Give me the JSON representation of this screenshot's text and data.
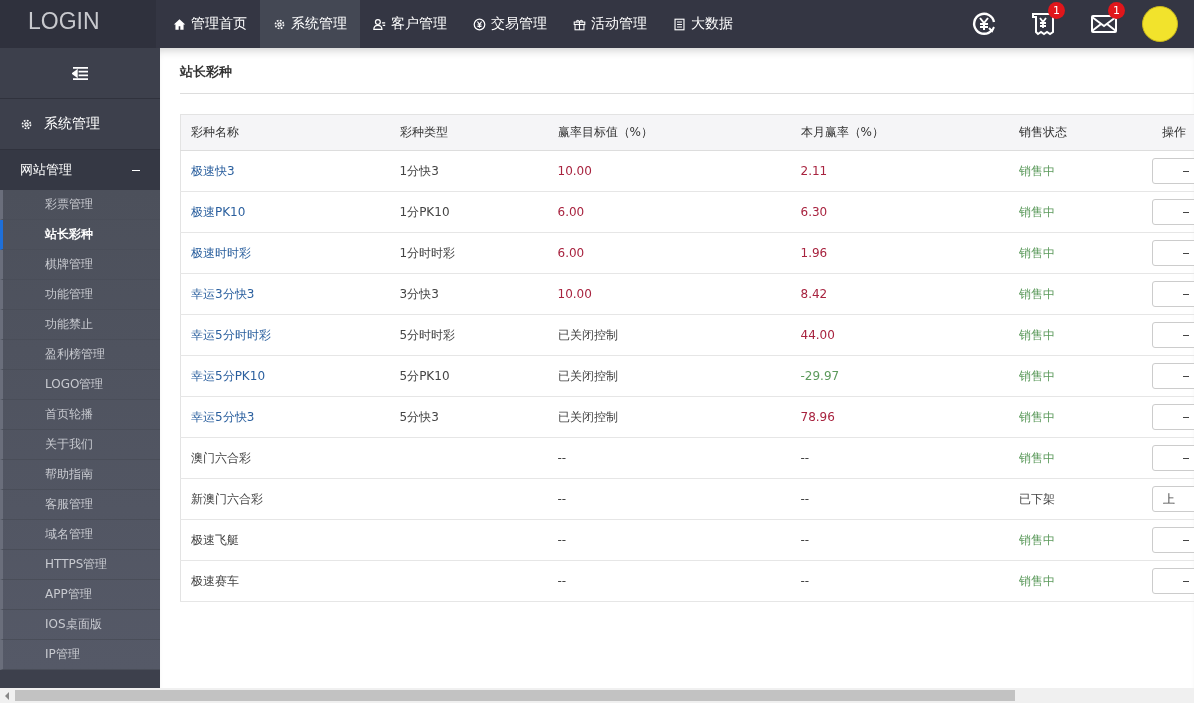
{
  "brand": "LOGIN",
  "nav": [
    {
      "label": "管理首页",
      "selected": false
    },
    {
      "label": "系统管理",
      "selected": true
    },
    {
      "label": "客户管理",
      "selected": false
    },
    {
      "label": "交易管理",
      "selected": false
    },
    {
      "label": "活动管理",
      "selected": false
    },
    {
      "label": "大数据",
      "selected": false
    }
  ],
  "header_icons": [
    {
      "kind": "plain"
    },
    {
      "kind": "badged",
      "badge": "1"
    },
    {
      "kind": "badged",
      "badge": "1"
    },
    {
      "kind": "avatar"
    }
  ],
  "sidebar": {
    "section": "系统管理",
    "group": {
      "label": "网站管理",
      "expanded": true,
      "items": [
        {
          "label": "彩票管理",
          "selected": false
        },
        {
          "label": "站长彩种",
          "selected": true
        },
        {
          "label": "棋牌管理",
          "selected": false
        },
        {
          "label": "功能管理",
          "selected": false
        },
        {
          "label": "功能禁止",
          "selected": false
        },
        {
          "label": "盈利榜管理",
          "selected": false
        },
        {
          "label": "LOGO管理",
          "selected": false
        },
        {
          "label": "首页轮播",
          "selected": false
        },
        {
          "label": "关于我们",
          "selected": false
        },
        {
          "label": "帮助指南",
          "selected": false
        },
        {
          "label": "客服管理",
          "selected": false
        },
        {
          "label": "域名管理",
          "selected": false
        },
        {
          "label": "HTTPS管理",
          "selected": false
        },
        {
          "label": "APP管理",
          "selected": false
        },
        {
          "label": "IOS桌面版",
          "selected": false
        },
        {
          "label": "IP管理",
          "selected": false
        }
      ]
    }
  },
  "page_title": "站长彩种",
  "table": {
    "columns": [
      "彩种名称",
      "彩种类型",
      "赢率目标值（%）",
      "本月赢率（%）",
      "销售状态",
      "操作"
    ],
    "rows": [
      {
        "name": "极速快3",
        "link": true,
        "type": "1分快3",
        "target": {
          "text": "10.00",
          "kind": "positive"
        },
        "month": {
          "text": "2.11",
          "kind": "positive"
        },
        "status": "销售中",
        "on_sale": true
      },
      {
        "name": "极速PK10",
        "link": true,
        "type": "1分PK10",
        "target": {
          "text": "6.00",
          "kind": "positive"
        },
        "month": {
          "text": "6.30",
          "kind": "positive"
        },
        "status": "销售中",
        "on_sale": true
      },
      {
        "name": "极速时时彩",
        "link": true,
        "type": "1分时时彩",
        "target": {
          "text": "6.00",
          "kind": "positive"
        },
        "month": {
          "text": "1.96",
          "kind": "positive"
        },
        "status": "销售中",
        "on_sale": true
      },
      {
        "name": "幸运3分快3",
        "link": true,
        "type": "3分快3",
        "target": {
          "text": "10.00",
          "kind": "positive"
        },
        "month": {
          "text": "8.42",
          "kind": "positive"
        },
        "status": "销售中",
        "on_sale": true
      },
      {
        "name": "幸运5分时时彩",
        "link": true,
        "type": "5分时时彩",
        "target": {
          "text": "已关闭控制",
          "kind": "none"
        },
        "month": {
          "text": "44.00",
          "kind": "positive"
        },
        "status": "销售中",
        "on_sale": true
      },
      {
        "name": "幸运5分PK10",
        "link": true,
        "type": "5分PK10",
        "target": {
          "text": "已关闭控制",
          "kind": "none"
        },
        "month": {
          "text": "-29.97",
          "kind": "negative"
        },
        "status": "销售中",
        "on_sale": true
      },
      {
        "name": "幸运5分快3",
        "link": true,
        "type": "5分快3",
        "target": {
          "text": "已关闭控制",
          "kind": "none"
        },
        "month": {
          "text": "78.96",
          "kind": "positive"
        },
        "status": "销售中",
        "on_sale": true
      },
      {
        "name": "澳门六合彩",
        "link": false,
        "target": {
          "text": "--",
          "kind": "none"
        },
        "month": {
          "text": "--",
          "kind": "none"
        },
        "status": "销售中",
        "on_sale": true
      },
      {
        "name": "新澳门六合彩",
        "link": false,
        "target": {
          "text": "--",
          "kind": "none"
        },
        "month": {
          "text": "--",
          "kind": "none"
        },
        "status": "已下架",
        "on_sale": false,
        "action": "上"
      },
      {
        "name": "极速飞艇",
        "link": false,
        "target": {
          "text": "--",
          "kind": "none"
        },
        "month": {
          "text": "--",
          "kind": "none"
        },
        "status": "销售中",
        "on_sale": true
      },
      {
        "name": "极速赛车",
        "link": false,
        "target": {
          "text": "--",
          "kind": "none"
        },
        "month": {
          "text": "--",
          "kind": "none"
        },
        "status": "销售中",
        "on_sale": true
      }
    ]
  }
}
